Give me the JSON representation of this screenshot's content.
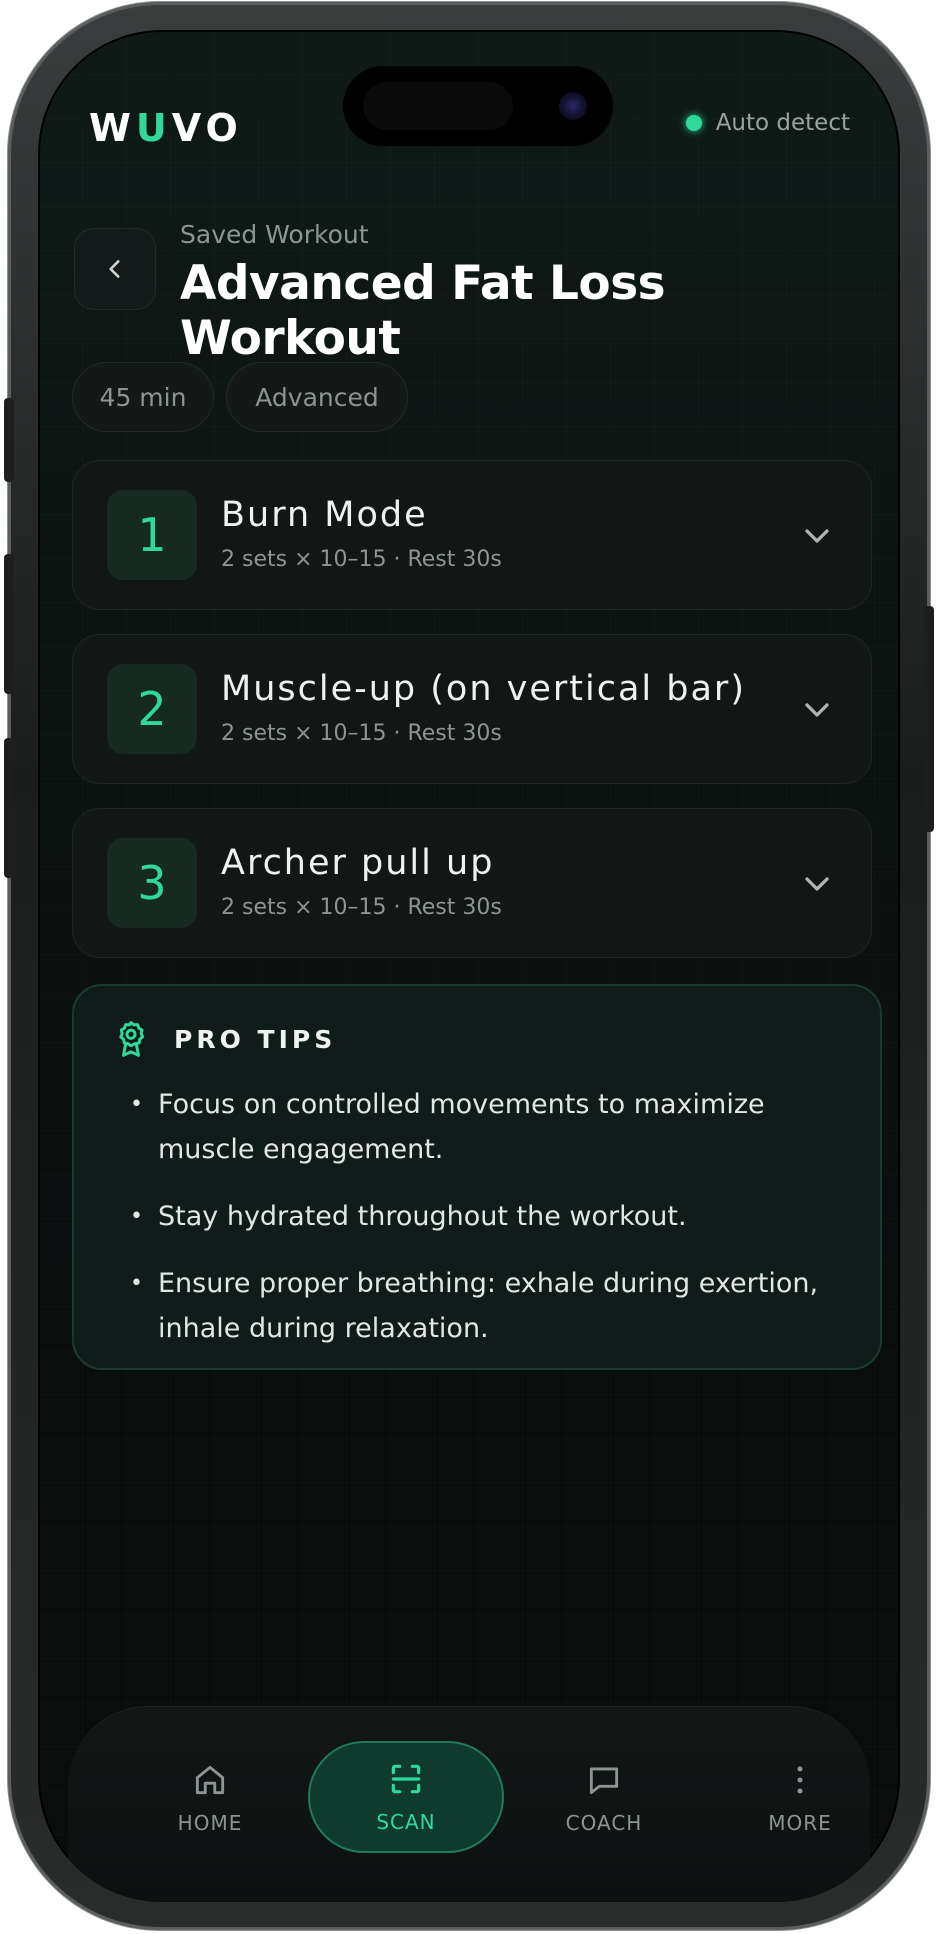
{
  "app": {
    "logo_prefix": "W",
    "logo_accent": "U",
    "logo_suffix": "VO",
    "accent_color": "#2fd99a"
  },
  "status": {
    "label": "Auto detect"
  },
  "header": {
    "subtitle": "Saved Workout",
    "title": "Advanced Fat Loss Workout",
    "back_icon": "chevron-left-icon"
  },
  "chips": [
    {
      "label": "45 min"
    },
    {
      "label": "Advanced"
    }
  ],
  "exercises": [
    {
      "number": "1",
      "name": "Burn Mode",
      "meta": "2 sets × 10–15 · Rest 30s"
    },
    {
      "number": "2",
      "name": "Muscle-up (on vertical bar)",
      "meta": "2 sets × 10–15 · Rest 30s"
    },
    {
      "number": "3",
      "name": "Archer pull up",
      "meta": "2 sets × 10–15 · Rest 30s"
    }
  ],
  "pro_tips": {
    "heading": "PRO TIPS",
    "icon": "award-icon",
    "items": [
      "Focus on controlled movements to maximize muscle engagement.",
      "Stay hydrated throughout the workout.",
      "Ensure proper breathing: exhale during exertion, inhale during relaxation."
    ]
  },
  "nav": {
    "items": [
      {
        "label": "HOME",
        "icon": "home-icon",
        "active": false
      },
      {
        "label": "SCAN",
        "icon": "scan-icon",
        "active": true
      },
      {
        "label": "COACH",
        "icon": "chat-icon",
        "active": false
      },
      {
        "label": "MORE",
        "icon": "more-vertical-icon",
        "active": false
      }
    ]
  }
}
